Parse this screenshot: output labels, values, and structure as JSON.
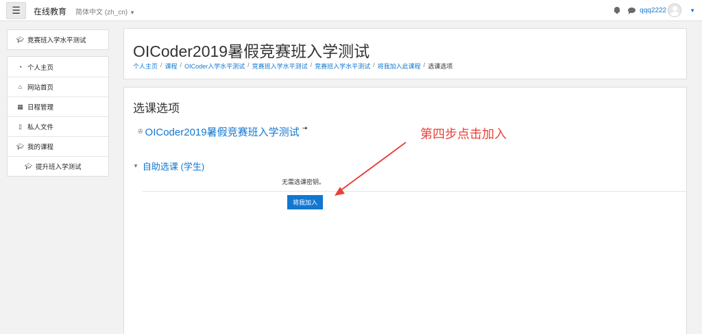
{
  "navbar": {
    "menu_icon": "☰",
    "site_name": "在线教育",
    "language": "简体中文 (zh_cn)",
    "username": "qqq2222"
  },
  "sidebar": {
    "top_block": {
      "label": "竞赛班入学水平测试",
      "icon": "graduation-cap-icon"
    },
    "nav": [
      {
        "label": "个人主页",
        "icon": "dashboard-icon"
      },
      {
        "label": "网站首页",
        "icon": "home-icon"
      },
      {
        "label": "日程管理",
        "icon": "calendar-icon"
      },
      {
        "label": "私人文件",
        "icon": "file-icon"
      },
      {
        "label": "我的课程",
        "icon": "graduation-cap-icon"
      },
      {
        "label": "提升班入学测试",
        "icon": "graduation-cap-icon"
      }
    ]
  },
  "header": {
    "title": "OICoder2019暑假竞赛班入学测试",
    "breadcrumb": [
      "个人主页",
      "课程",
      "OICoder入学水平测试",
      "竞赛班入学水平测试",
      "竞赛班入学水平测试",
      "将我加入此课程",
      "选课选项"
    ]
  },
  "main": {
    "section_title": "选课选项",
    "course_name": "OICoder2019暑假竞赛班入学测试",
    "enrol_method_title": "自助选课 (学生)",
    "no_key_text": "无需选课密钥。",
    "enrol_button": "将我加入"
  },
  "annotation": {
    "text": "第四步点击加入",
    "color": "#e8403a"
  },
  "colors": {
    "link": "#1177d1",
    "button": "#1177d1",
    "background": "#f2f2f2"
  }
}
